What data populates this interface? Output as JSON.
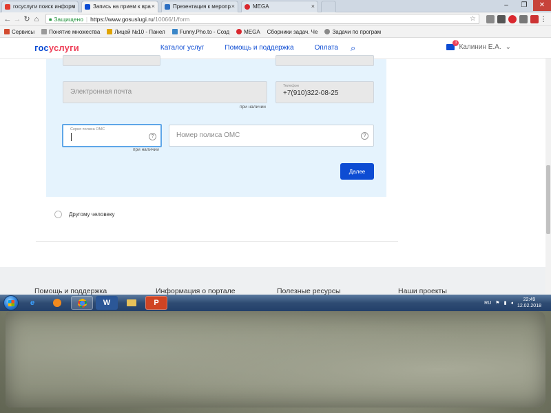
{
  "browser": {
    "tabs": [
      {
        "label": "госуслуги поиск информ",
        "icon_color": "#e23b2e"
      },
      {
        "label": "Запись на прием к вра",
        "icon_color": "#0d4cd3"
      },
      {
        "label": "Презентация к меропр",
        "icon_color": "#2d6fc2"
      },
      {
        "label": "MEGA",
        "icon_color": "#d9272e"
      }
    ],
    "address": {
      "secure_label": "Защищено",
      "host": "https://www.gosuslugi.ru",
      "path": "/10066/1/form"
    },
    "bookmarks": [
      {
        "label": "Сервисы",
        "color": "#d24b2f"
      },
      {
        "label": "Понятие множества",
        "color": "#9a9a9a"
      },
      {
        "label": "Лицей №10 - Панел",
        "color": "#e0a400"
      },
      {
        "label": "Funny.Pho.to - Созд",
        "color": "#3a86c8"
      },
      {
        "label": "MEGA",
        "color": "#d9272e"
      },
      {
        "label": "Сборники задач. Че",
        "color": "#9a9a9a"
      },
      {
        "label": "Задачи по програм",
        "color": "#888888"
      }
    ]
  },
  "site": {
    "logo_part1": "гос",
    "logo_part2": "услуги",
    "nav": [
      "Каталог услуг",
      "Помощь и поддержка",
      "Оплата"
    ],
    "user_name": "Калинин Е.А.",
    "notif_count": "1"
  },
  "form": {
    "email_placeholder": "Электронная почта",
    "email_hint": "при наличии",
    "phone_label": "Телефон",
    "phone_value": "+7(910)322-08-25",
    "oms_series_label": "Серия полиса ОМС",
    "oms_series_hint": "при наличии",
    "oms_number_placeholder": "Номер полиса ОМС",
    "help_symbol": "?",
    "next_button": "Далее",
    "radio_other": "Другому человеку"
  },
  "footer": [
    "Помощь и поддержка",
    "Информация о портале",
    "Полезные ресурсы",
    "Наши проекты"
  ],
  "taskbar": {
    "lang": "RU",
    "time": "22:49",
    "date": "12.02.2018"
  },
  "colors": {
    "brand_blue": "#0d4cd3",
    "brand_red": "#ee3f58",
    "panel_bg": "#e5f3fd"
  }
}
